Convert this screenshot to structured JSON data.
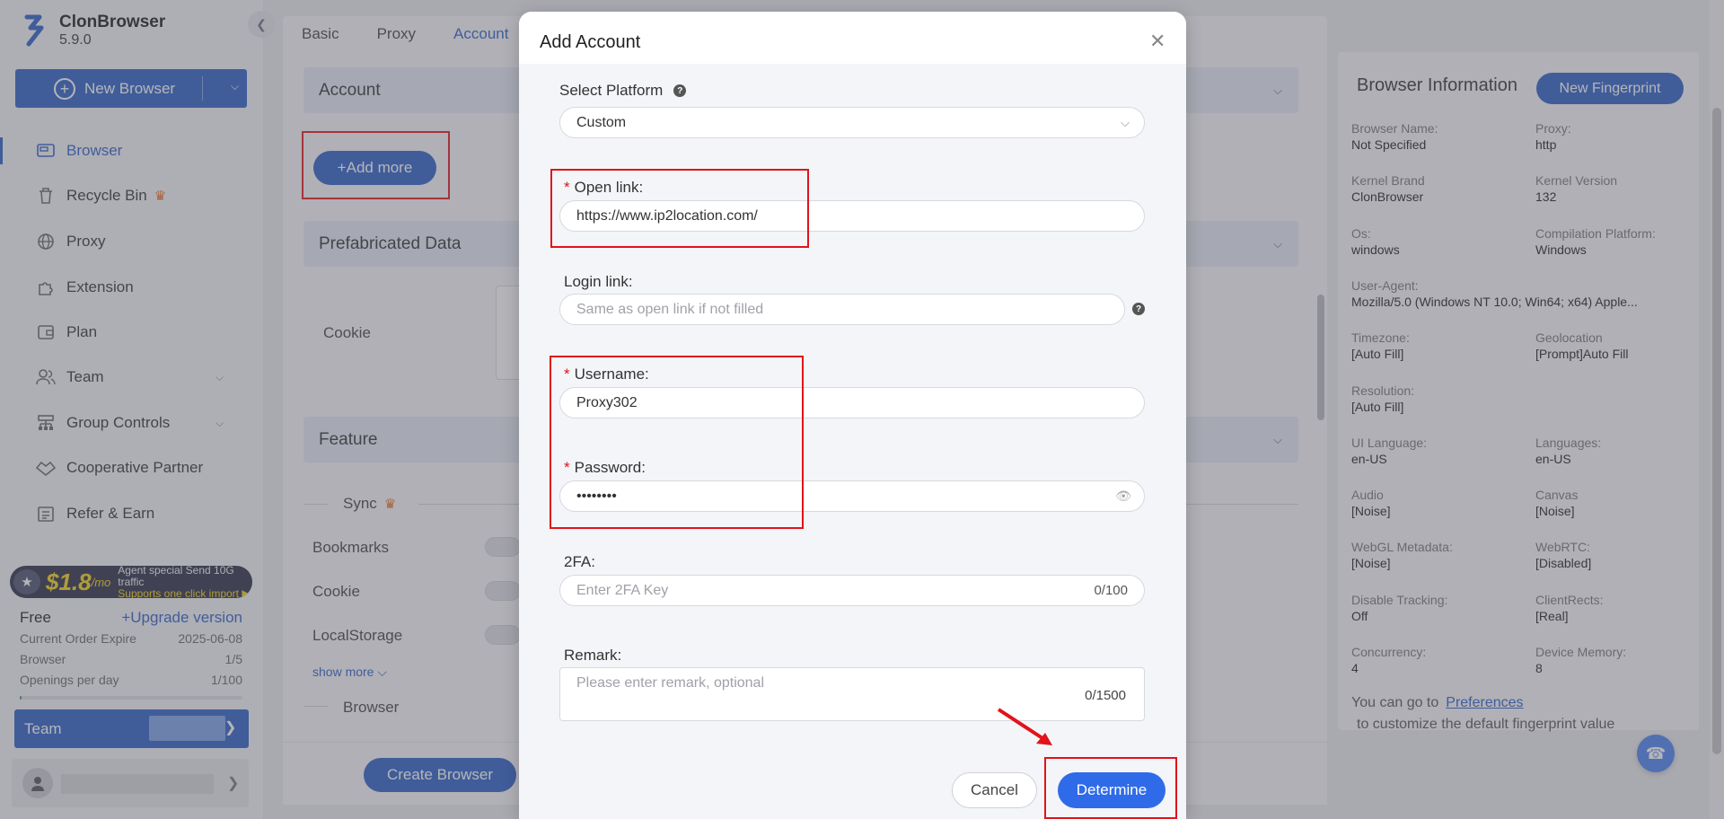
{
  "app": {
    "name": "ClonBrowser",
    "version": "5.9.0"
  },
  "sidebar": {
    "new_browser": "New Browser",
    "items": [
      {
        "label": "Browser",
        "icon": "browser-icon"
      },
      {
        "label": "Recycle Bin",
        "icon": "trash-icon"
      },
      {
        "label": "Proxy",
        "icon": "globe-icon"
      },
      {
        "label": "Extension",
        "icon": "puzzle-icon"
      },
      {
        "label": "Plan",
        "icon": "wallet-icon"
      },
      {
        "label": "Team",
        "icon": "team-icon"
      },
      {
        "label": "Group Controls",
        "icon": "group-controls-icon"
      },
      {
        "label": "Cooperative Partner",
        "icon": "handshake-icon"
      },
      {
        "label": "Refer & Earn",
        "icon": "gift-icon"
      }
    ],
    "promo": {
      "price": "$1.8",
      "per": "/mo",
      "line1": "Agent special Send 10G traffic",
      "line2": "Supports one click import ▶"
    },
    "plan": {
      "name": "Free",
      "upgrade": "+Upgrade version",
      "expire_label": "Current Order Expire",
      "expire_value": "2025-06-08",
      "browser_label": "Browser",
      "browser_value": "1/5",
      "openings_label": "Openings per day",
      "openings_value": "1/100",
      "usage_fraction": 0.01
    },
    "team_button": "Team"
  },
  "tabs": [
    "Basic",
    "Proxy",
    "Account"
  ],
  "main": {
    "account_section": "Account",
    "add_more": "+Add more",
    "prefab_section": "Prefabricated Data",
    "cookie_label": "Cookie",
    "feature_section": "Feature",
    "sync_label": "Sync",
    "bookmarks": "Bookmarks",
    "cookie": "Cookie",
    "localstorage": "LocalStorage",
    "show_more": "show more",
    "browser_label": "Browser",
    "create_browser": "Create Browser"
  },
  "info": {
    "title": "Browser Information",
    "new_fingerprint": "New Fingerprint",
    "fields": [
      {
        "k": "Browser Name:",
        "v": "Not Specified"
      },
      {
        "k": "Proxy:",
        "v": "http"
      },
      {
        "k": "Kernel Brand",
        "v": "ClonBrowser"
      },
      {
        "k": "Kernel Version",
        "v": "132"
      },
      {
        "k": "Os:",
        "v": "windows"
      },
      {
        "k": "Compilation Platform:",
        "v": "Windows"
      },
      {
        "k": "User-Agent:",
        "v": "Mozilla/5.0 (Windows NT 10.0; Win64; x64) Apple..."
      },
      {
        "k": "Timezone:",
        "v": "[Auto Fill]"
      },
      {
        "k": "Geolocation",
        "v": "[Prompt]Auto Fill"
      },
      {
        "k": "Resolution:",
        "v": "[Auto Fill]"
      },
      {
        "k": "UI Language:",
        "v": "en-US"
      },
      {
        "k": "Languages:",
        "v": "en-US"
      },
      {
        "k": "Audio",
        "v": "[Noise]"
      },
      {
        "k": "Canvas",
        "v": "[Noise]"
      },
      {
        "k": "WebGL Metadata:",
        "v": "[Noise]"
      },
      {
        "k": "WebRTC:",
        "v": "[Disabled]"
      },
      {
        "k": "Disable Tracking:",
        "v": "Off"
      },
      {
        "k": "ClientRects:",
        "v": "[Real]"
      },
      {
        "k": "Concurrency:",
        "v": "4"
      },
      {
        "k": "Device Memory:",
        "v": "8"
      }
    ],
    "pref_prefix": "You can go to",
    "pref_link": "Preferences",
    "pref_suffix": "to customize the default fingerprint value"
  },
  "modal": {
    "title": "Add Account",
    "platform_label": "Select Platform",
    "platform_value": "Custom",
    "open_link_label": "Open link:",
    "open_link_value": "https://www.ip2location.com/",
    "login_link_label": "Login link:",
    "login_link_placeholder": "Same as open link if not filled",
    "username_label": "Username:",
    "username_value": "Proxy302",
    "password_label": "Password:",
    "password_value": "••••••••",
    "twofa_label": "2FA:",
    "twofa_placeholder": "Enter 2FA Key",
    "twofa_count": "0/100",
    "remark_label": "Remark:",
    "remark_placeholder": "Please enter remark, optional",
    "remark_count": "0/1500",
    "cancel": "Cancel",
    "determine": "Determine"
  },
  "colors": {
    "accent": "#2b60c6",
    "annotation": "#e0141a",
    "crown": "#e46b1a"
  }
}
